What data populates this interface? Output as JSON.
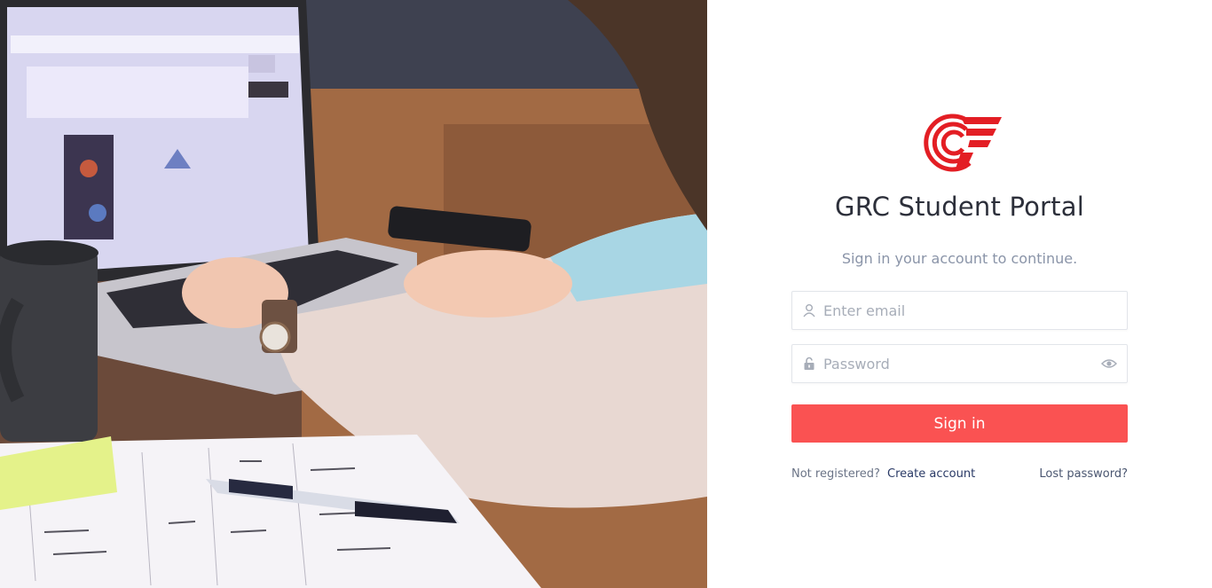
{
  "brand": {
    "title": "GRC Student Portal",
    "subtitle": "Sign in your account to continue.",
    "logo_color": "#e31e24"
  },
  "form": {
    "email_placeholder": "Enter email",
    "email_value": "",
    "password_placeholder": "Password",
    "password_value": "",
    "signin_label": "Sign in",
    "email_icon": "user-icon",
    "password_icon": "lock-icon",
    "visibility_icon": "eye-icon"
  },
  "footer": {
    "not_registered_text": "Not registered?",
    "create_account_label": "Create account",
    "lost_password_label": "Lost password?"
  },
  "colors": {
    "accent": "#fa5252",
    "title": "#2c2f3a",
    "muted": "#8a94a8",
    "link": "#2a3a66"
  },
  "hero": {
    "image": "student-laptop-photo"
  }
}
